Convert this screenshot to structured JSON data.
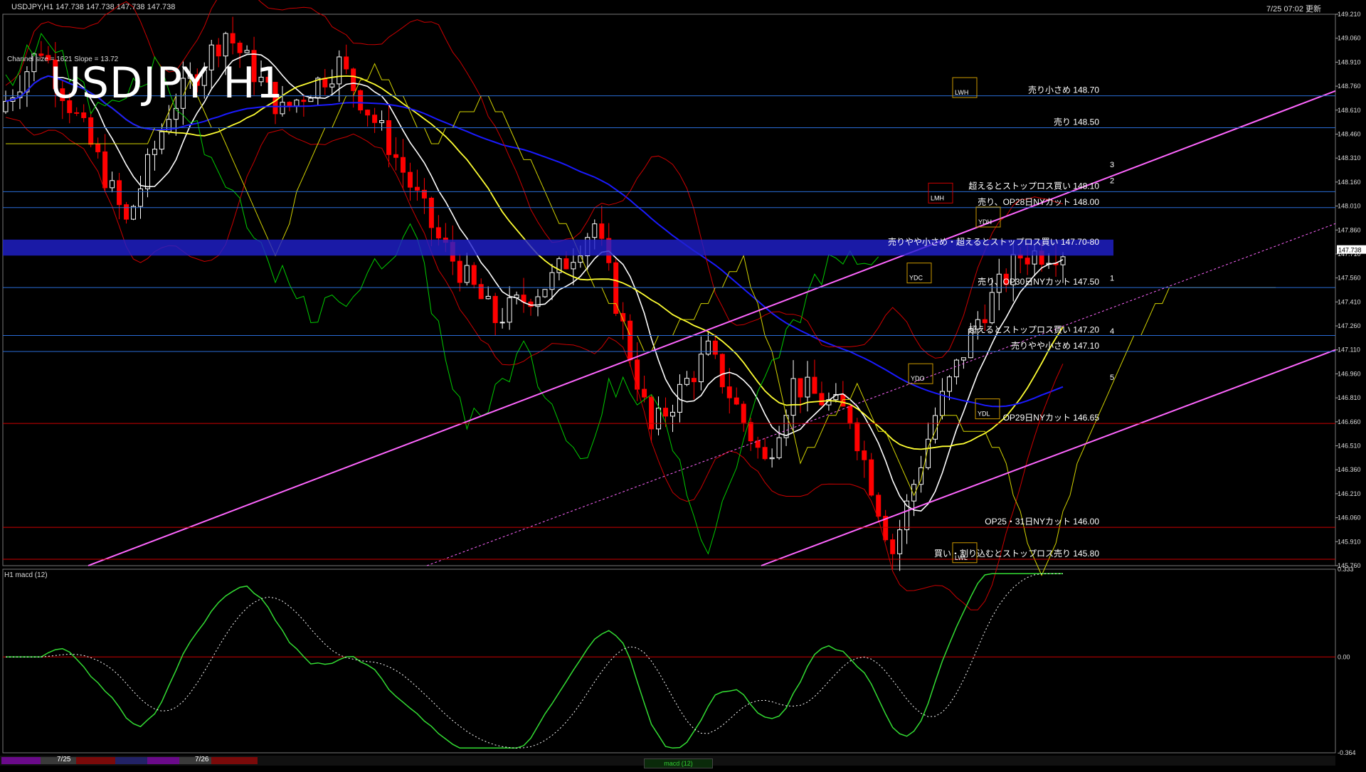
{
  "header": {
    "symbol_info": "USDJPY,H1  147.738 147.738 147.738 147.738",
    "timestamp": "7/25 07:02 更新",
    "big_title": "USDJPY H1",
    "channel_info": "Channel size = 1621 Slope = 13.72",
    "macd_label": "H1  macd (12)",
    "current_price": "147.738"
  },
  "colors": {
    "background": "#000000",
    "bull_candle": "#ffffff",
    "bear_candle": "#ff0000",
    "sma_fast": "#ffffff",
    "sma_mid": "#ffff33",
    "sma_slow": "#1a1aff",
    "bollinger": "#cc0000",
    "channel": "#ff66ff",
    "chikou": "#00cc00",
    "cloud_upper": "#d4d400",
    "level_blue": "#2a6cd6",
    "level_red": "#cc0000",
    "macd_main": "#33dd33",
    "macd_bear": "#ff88aa",
    "macd_signal": "#ffffff"
  },
  "bottom_bar": {
    "dates": [
      "7/25",
      "7/26"
    ],
    "tab": "macd (12)"
  },
  "chart_data": {
    "type": "candlestick",
    "symbol": "USDJPY",
    "timeframe": "H1",
    "price_axis": {
      "min": 145.76,
      "max": 149.21,
      "ticks": [
        "149.210",
        "149.060",
        "148.910",
        "148.760",
        "148.610",
        "148.460",
        "148.310",
        "148.160",
        "148.010",
        "147.860",
        "147.710",
        "147.560",
        "147.410",
        "147.260",
        "147.110",
        "146.960",
        "146.810",
        "146.660",
        "146.510",
        "146.360",
        "146.210",
        "146.060",
        "145.910",
        "145.760"
      ]
    },
    "macd_axis": {
      "ticks": [
        "0.333",
        "0.00",
        "-0.364"
      ],
      "min": -0.364,
      "max": 0.333
    },
    "candle_count": 150,
    "candles_summary": {
      "start": 148.6,
      "high_zone": 149.1,
      "low_zone": 145.85,
      "end": 147.738
    },
    "price_levels": [
      {
        "price": 148.7,
        "label": "売り小さめ 148.70",
        "color": "blue"
      },
      {
        "price": 148.5,
        "label": "売り 148.50",
        "color": "blue"
      },
      {
        "price": 148.1,
        "label": "超えるとストップロス買い 148.10",
        "color": "blue"
      },
      {
        "price": 148.0,
        "label": "売り、OP28日NYカット 148.00",
        "color": "blue"
      },
      {
        "price": 147.75,
        "label": "売りやや小さめ・超えるとストップロス買い 147.70-80",
        "color": "band"
      },
      {
        "price": 147.5,
        "label": "売り、OP30日NYカット 147.50",
        "color": "blue"
      },
      {
        "price": 147.2,
        "label": "超えるとストップロス買い 147.20",
        "color": "blue"
      },
      {
        "price": 147.1,
        "label": "売りやや小さめ 147.10",
        "color": "blue"
      },
      {
        "price": 146.65,
        "label": "OP29日NYカット 146.65",
        "color": "red"
      },
      {
        "price": 146.0,
        "label": "OP25・31日NYカット 146.00",
        "color": "red"
      },
      {
        "price": 145.8,
        "label": "買い・割り込むとストップロス売り 145.80",
        "color": "red"
      }
    ],
    "box_labels": [
      "LWH",
      "LMH",
      "YDH",
      "YDC",
      "YDO",
      "YDL",
      "LWL"
    ],
    "wave_labels": [
      "1",
      "2",
      "3",
      "4",
      "5"
    ]
  }
}
